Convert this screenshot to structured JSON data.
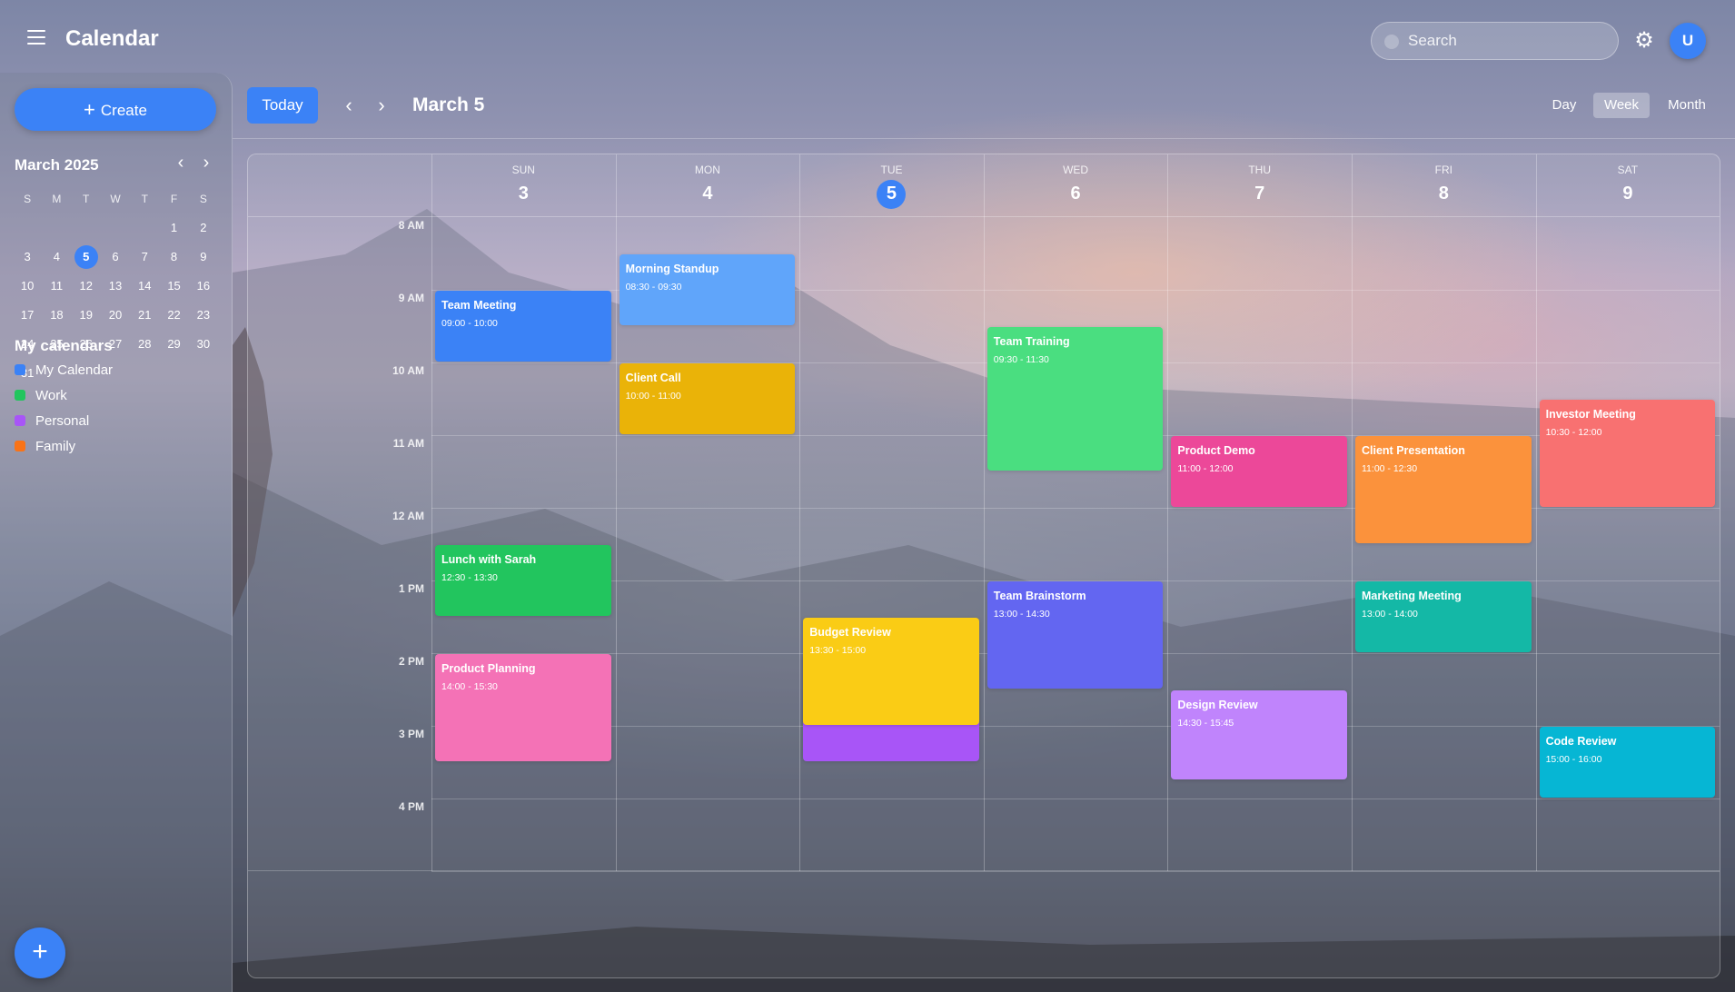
{
  "header": {
    "title": "Calendar",
    "search_placeholder": "Search",
    "avatar_initial": "U"
  },
  "sidebar": {
    "create_label": "Create",
    "mini_cal": {
      "month_label": "March 2025",
      "weekdays": [
        "S",
        "M",
        "T",
        "W",
        "T",
        "F",
        "S"
      ],
      "weeks": [
        [
          "",
          "",
          "",
          "",
          "",
          "1",
          "2"
        ],
        [
          "3",
          "4",
          "5",
          "6",
          "7",
          "8",
          "9"
        ],
        [
          "10",
          "11",
          "12",
          "13",
          "14",
          "15",
          "16"
        ],
        [
          "17",
          "18",
          "19",
          "20",
          "21",
          "22",
          "23"
        ],
        [
          "24",
          "25",
          "26",
          "27",
          "28",
          "29",
          "30"
        ],
        [
          "31",
          "",
          "",
          "",
          "",
          "",
          ""
        ]
      ],
      "selected": "5"
    },
    "calendars_title": "My calendars",
    "calendars": [
      {
        "name": "My Calendar",
        "color": "#3b82f6"
      },
      {
        "name": "Work",
        "color": "#22c55e"
      },
      {
        "name": "Personal",
        "color": "#a855f7"
      },
      {
        "name": "Family",
        "color": "#f97316"
      }
    ],
    "fab_label": "+"
  },
  "toolbar": {
    "today_label": "Today",
    "current_date": "March 5",
    "views": [
      "Day",
      "Week",
      "Month"
    ],
    "active_view": "Week"
  },
  "week": {
    "days": [
      {
        "dow": "SUN",
        "num": "3"
      },
      {
        "dow": "MON",
        "num": "4"
      },
      {
        "dow": "TUE",
        "num": "5",
        "today": true
      },
      {
        "dow": "WED",
        "num": "6"
      },
      {
        "dow": "THU",
        "num": "7"
      },
      {
        "dow": "FRI",
        "num": "8"
      },
      {
        "dow": "SAT",
        "num": "9"
      }
    ],
    "hours": [
      "8 AM",
      "9 AM",
      "10 AM",
      "11 AM",
      "12 AM",
      "1 PM",
      "2 PM",
      "3 PM",
      "4 PM"
    ],
    "events": [
      {
        "title": "Team Meeting",
        "time": "09:00 - 10:00",
        "day": 0,
        "start": 9.0,
        "end": 10.0,
        "color": "#3b82f6"
      },
      {
        "title": "Lunch with Sarah",
        "time": "12:30 - 13:30",
        "day": 0,
        "start": 12.5,
        "end": 13.5,
        "color": "#22c55e"
      },
      {
        "title": "Product Planning",
        "time": "14:00 - 15:30",
        "day": 0,
        "start": 14.0,
        "end": 15.5,
        "color": "#f472b6"
      },
      {
        "title": "Morning Standup",
        "time": "08:30 - 09:30",
        "day": 1,
        "start": 8.5,
        "end": 9.5,
        "color": "#60a5fa"
      },
      {
        "title": "Client Call",
        "time": "10:00 - 11:00",
        "day": 1,
        "start": 10.0,
        "end": 11.0,
        "color": "#eab308"
      },
      {
        "title": "",
        "time": "",
        "day": 2,
        "start": 14.0,
        "end": 15.5,
        "color": "#a855f7"
      },
      {
        "title": "Budget Review",
        "time": "13:30 - 15:00",
        "day": 2,
        "start": 13.5,
        "end": 15.0,
        "color": "#facc15"
      },
      {
        "title": "Team Training",
        "time": "09:30 - 11:30",
        "day": 3,
        "start": 9.5,
        "end": 11.5,
        "color": "#4ade80"
      },
      {
        "title": "Team Brainstorm",
        "time": "13:00 - 14:30",
        "day": 3,
        "start": 13.0,
        "end": 14.5,
        "color": "#6366f1"
      },
      {
        "title": "Product Demo",
        "time": "11:00 - 12:00",
        "day": 4,
        "start": 11.0,
        "end": 12.0,
        "color": "#ec4899"
      },
      {
        "title": "Design Review",
        "time": "14:30 - 15:45",
        "day": 4,
        "start": 14.5,
        "end": 15.75,
        "color": "#c084fc"
      },
      {
        "title": "Client Presentation",
        "time": "11:00 - 12:30",
        "day": 5,
        "start": 11.0,
        "end": 12.5,
        "color": "#fb923c"
      },
      {
        "title": "Marketing Meeting",
        "time": "13:00 - 14:00",
        "day": 5,
        "start": 13.0,
        "end": 14.0,
        "color": "#14b8a6"
      },
      {
        "title": "Investor Meeting",
        "time": "10:30 - 12:00",
        "day": 6,
        "start": 10.5,
        "end": 12.0,
        "color": "#f87171"
      },
      {
        "title": "Code Review",
        "time": "15:00 - 16:00",
        "day": 6,
        "start": 15.0,
        "end": 16.0,
        "color": "#06b6d4"
      }
    ]
  }
}
